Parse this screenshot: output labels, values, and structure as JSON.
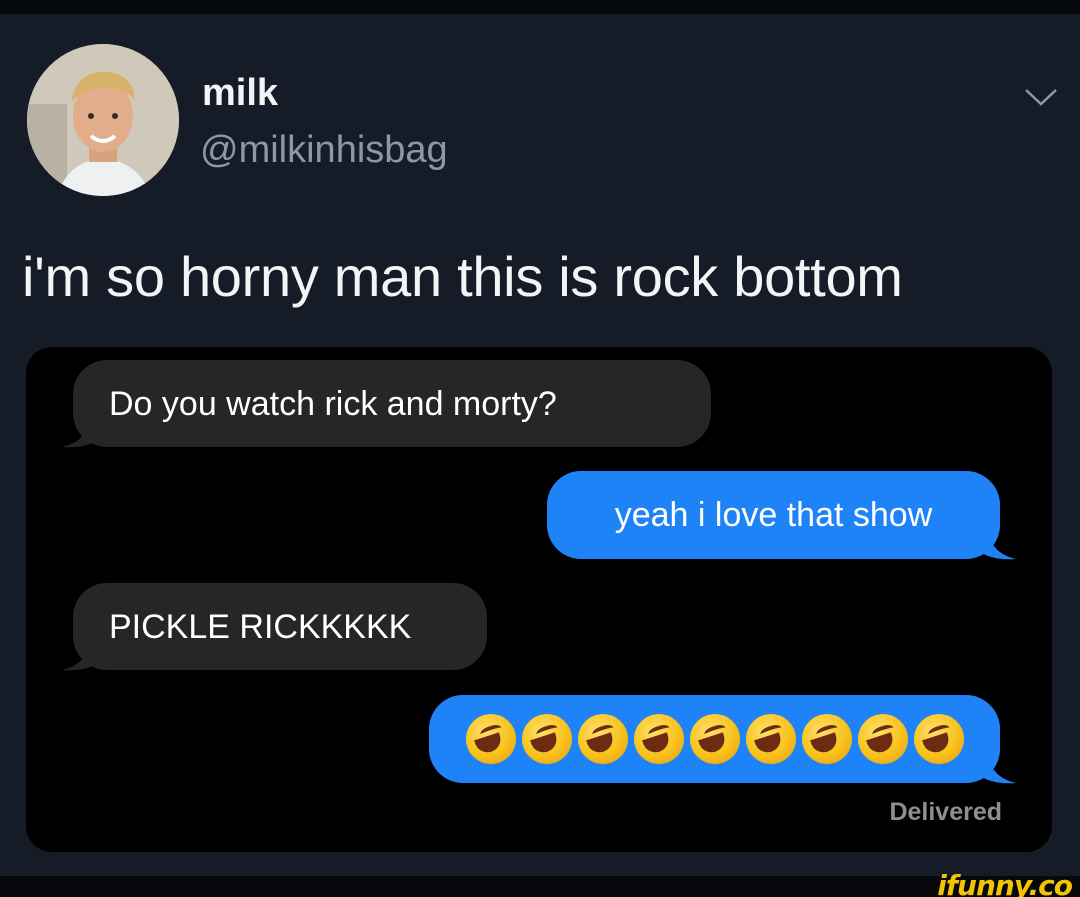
{
  "author": {
    "name": "milk",
    "handle": "@milkinhisbag"
  },
  "tweet": {
    "text": "i'm so horny man this is rock bottom"
  },
  "chat": {
    "messages": [
      {
        "sender": "them",
        "text": "Do you watch rick and morty?"
      },
      {
        "sender": "me",
        "text": "yeah i love that show"
      },
      {
        "sender": "them",
        "text": "PICKLE RICKKKKK"
      },
      {
        "sender": "me",
        "emoji": "rolling-on-the-floor-laughing",
        "count": 9
      }
    ],
    "status": "Delivered"
  },
  "colors": {
    "tweet_background": "#151c28",
    "sent_bubble": "#1e83f7",
    "received_bubble": "#262629",
    "watermark": "#f5c400"
  }
}
